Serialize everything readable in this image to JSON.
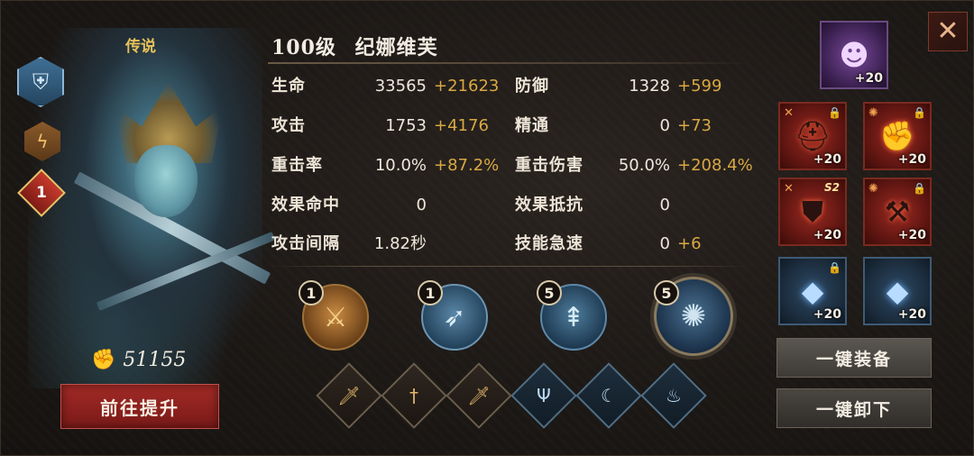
{
  "hero": {
    "rarity": "传说",
    "level": "100级",
    "name": "纪娜维芙",
    "star": "1",
    "power": "51155",
    "class_icon": "tower-shield-icon",
    "element_icon": "lightning-icon",
    "upgrade_label": "前往提升"
  },
  "stats": [
    {
      "l_label": "生命",
      "l_value": "33565",
      "l_bonus": "+21623",
      "r_label": "防御",
      "r_value": "1328",
      "r_bonus": "+599"
    },
    {
      "l_label": "攻击",
      "l_value": "1753",
      "l_bonus": "+4176",
      "r_label": "精通",
      "r_value": "0",
      "r_bonus": "+73"
    },
    {
      "l_label": "重击率",
      "l_value": "10.0%",
      "l_bonus": "+87.2%",
      "r_label": "重击伤害",
      "r_value": "50.0%",
      "r_bonus": "+208.4%"
    },
    {
      "l_label": "效果命中",
      "l_value": "0",
      "l_bonus": "",
      "r_label": "效果抵抗",
      "r_value": "0",
      "r_bonus": ""
    },
    {
      "l_label": "攻击间隔",
      "l_value": "1.82秒",
      "l_bonus": "",
      "r_label": "技能急速",
      "r_value": "0",
      "r_bonus": "+6"
    }
  ],
  "skills": [
    {
      "level": "1",
      "icon": "crossed-swords-icon"
    },
    {
      "level": "1",
      "icon": "feather-slash-icon"
    },
    {
      "level": "5",
      "icon": "spear-burst-icon"
    },
    {
      "level": "5",
      "icon": "vortex-icon"
    }
  ],
  "passives": [
    {
      "icon": "sword-icon",
      "style": "gold"
    },
    {
      "icon": "dagger-icon",
      "style": "gold"
    },
    {
      "icon": "sword-icon",
      "style": "gold"
    },
    {
      "icon": "trident-icon",
      "style": "blue"
    },
    {
      "icon": "sickle-icon",
      "style": "blue"
    },
    {
      "icon": "flame-crown-icon",
      "style": "blue"
    }
  ],
  "equipment": {
    "artifact": {
      "plus": "+20",
      "icon": "mask-icon"
    },
    "slots": [
      {
        "plus": "+20",
        "icon": "helmet-icon",
        "locked": true
      },
      {
        "plus": "+20",
        "icon": "gauntlet-icon",
        "locked": true
      },
      {
        "plus": "+20",
        "icon": "armor-icon",
        "locked": false,
        "tag": "S2"
      },
      {
        "plus": "+20",
        "icon": "bracer-icon",
        "locked": true
      },
      {
        "plus": "+20",
        "icon": "crystal-icon",
        "locked": true
      },
      {
        "plus": "+20",
        "icon": "crystal-icon",
        "locked": false
      }
    ]
  },
  "actions": {
    "equip_all": "一键装备",
    "unequip_all": "一键卸下"
  },
  "colors": {
    "bonus": "#d9a844",
    "upgrade_button": "#a22a26",
    "rarity": "#e6c15a"
  }
}
